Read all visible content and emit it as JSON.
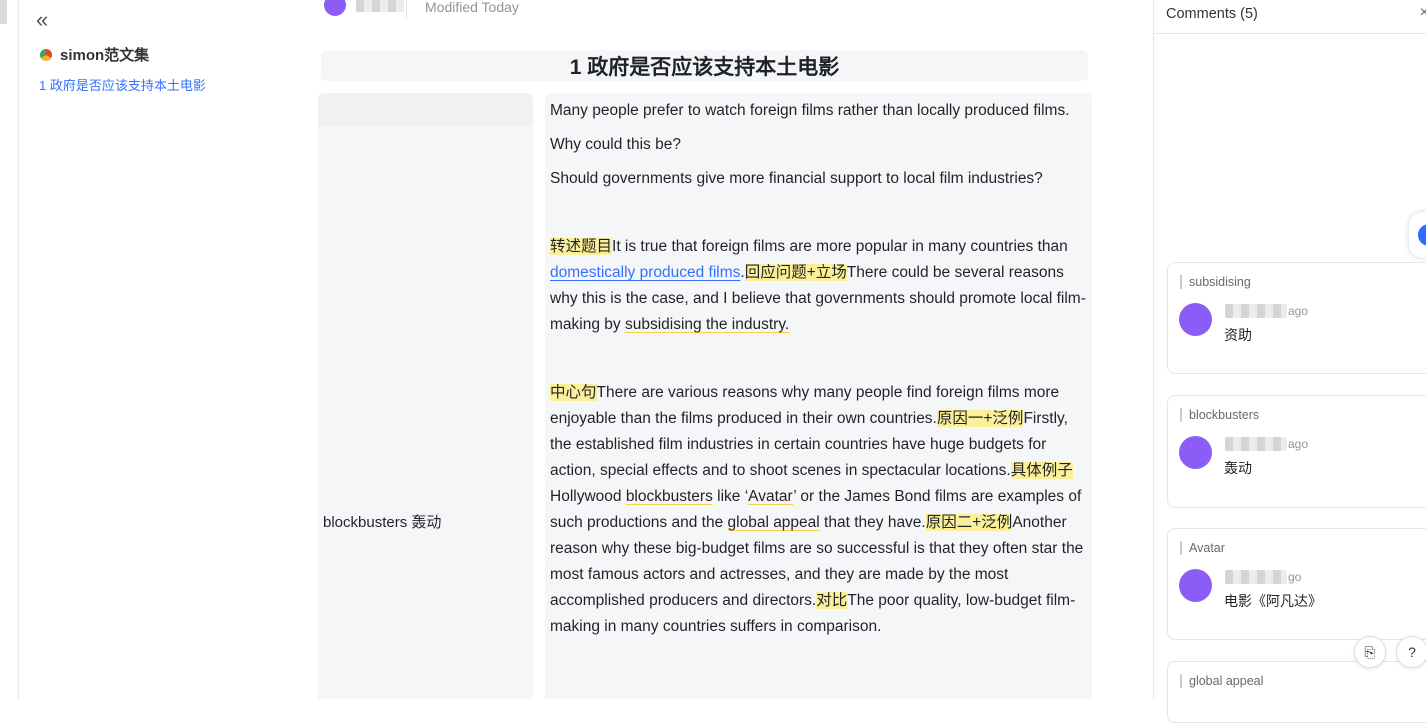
{
  "sidebar": {
    "collapse_glyph": "«",
    "workspace_title": "simon范文集",
    "nav_item": "1 政府是否应该支持本土电影"
  },
  "doc": {
    "modified": "Modified Today",
    "title": "1 政府是否应该支持本土电影",
    "left_cell_vocab": "blockbusters  轰动",
    "prompt": [
      "Many people prefer to watch foreign films rather than locally produced films.",
      "Why could this be?",
      "Should governments give more financial support to local film industries?"
    ],
    "para1": {
      "tag1": "转述题目",
      "text1": "It is true that foreign films are more popular in many countries than ",
      "link": "domestically produced films",
      "text2": ".",
      "tag2": "回应问题+立场",
      "text3": "There could be several reasons why this is the case, and I believe that governments should promote local film-making by ",
      "underlined": "subsidising the industry."
    },
    "para2": {
      "tag1": "中心句",
      "text1": "There are various reasons why many people find foreign films more enjoyable than the films produced in their own countries.",
      "tag2": "原因一+泛例",
      "text2": "Firstly, the established film industries in certain countries have huge budgets for action, special effects and to shoot scenes in spectacular locations.",
      "tag3": "具体例子",
      "text3": "Hollywood ",
      "u1": "blockbusters",
      "text4": " like ‘",
      "u2": "Avatar",
      "text5": "’ or the James Bond films are examples of such productions and the ",
      "u3": "global appeal",
      "text6": " that they have.",
      "tag4": "原因二+泛例",
      "text7": "Another reason why these big-budget films are so successful is that they often star the most famous actors and actresses, and they are made by the most accomplished producers and directors.",
      "tag5": "对比",
      "text8": "The poor quality, low-budget film-making in many countries suffers in comparison."
    }
  },
  "comments": {
    "header": "Comments (5)",
    "close_glyph": "×",
    "items": [
      {
        "quote": "subsidising",
        "time": "ago",
        "text": "资助"
      },
      {
        "quote": "blockbusters",
        "time": "ago",
        "text": "轰动"
      },
      {
        "quote": "Avatar",
        "time": "go",
        "text": "电影《阿凡达》"
      },
      {
        "quote": "global appeal",
        "time": "",
        "text": ""
      }
    ]
  },
  "floating": {
    "history_glyph": "⎘",
    "help_glyph": "?"
  },
  "colors": {
    "highlight": "#fbf099",
    "link": "#3370ff",
    "avatar": "#8b5cf6"
  }
}
